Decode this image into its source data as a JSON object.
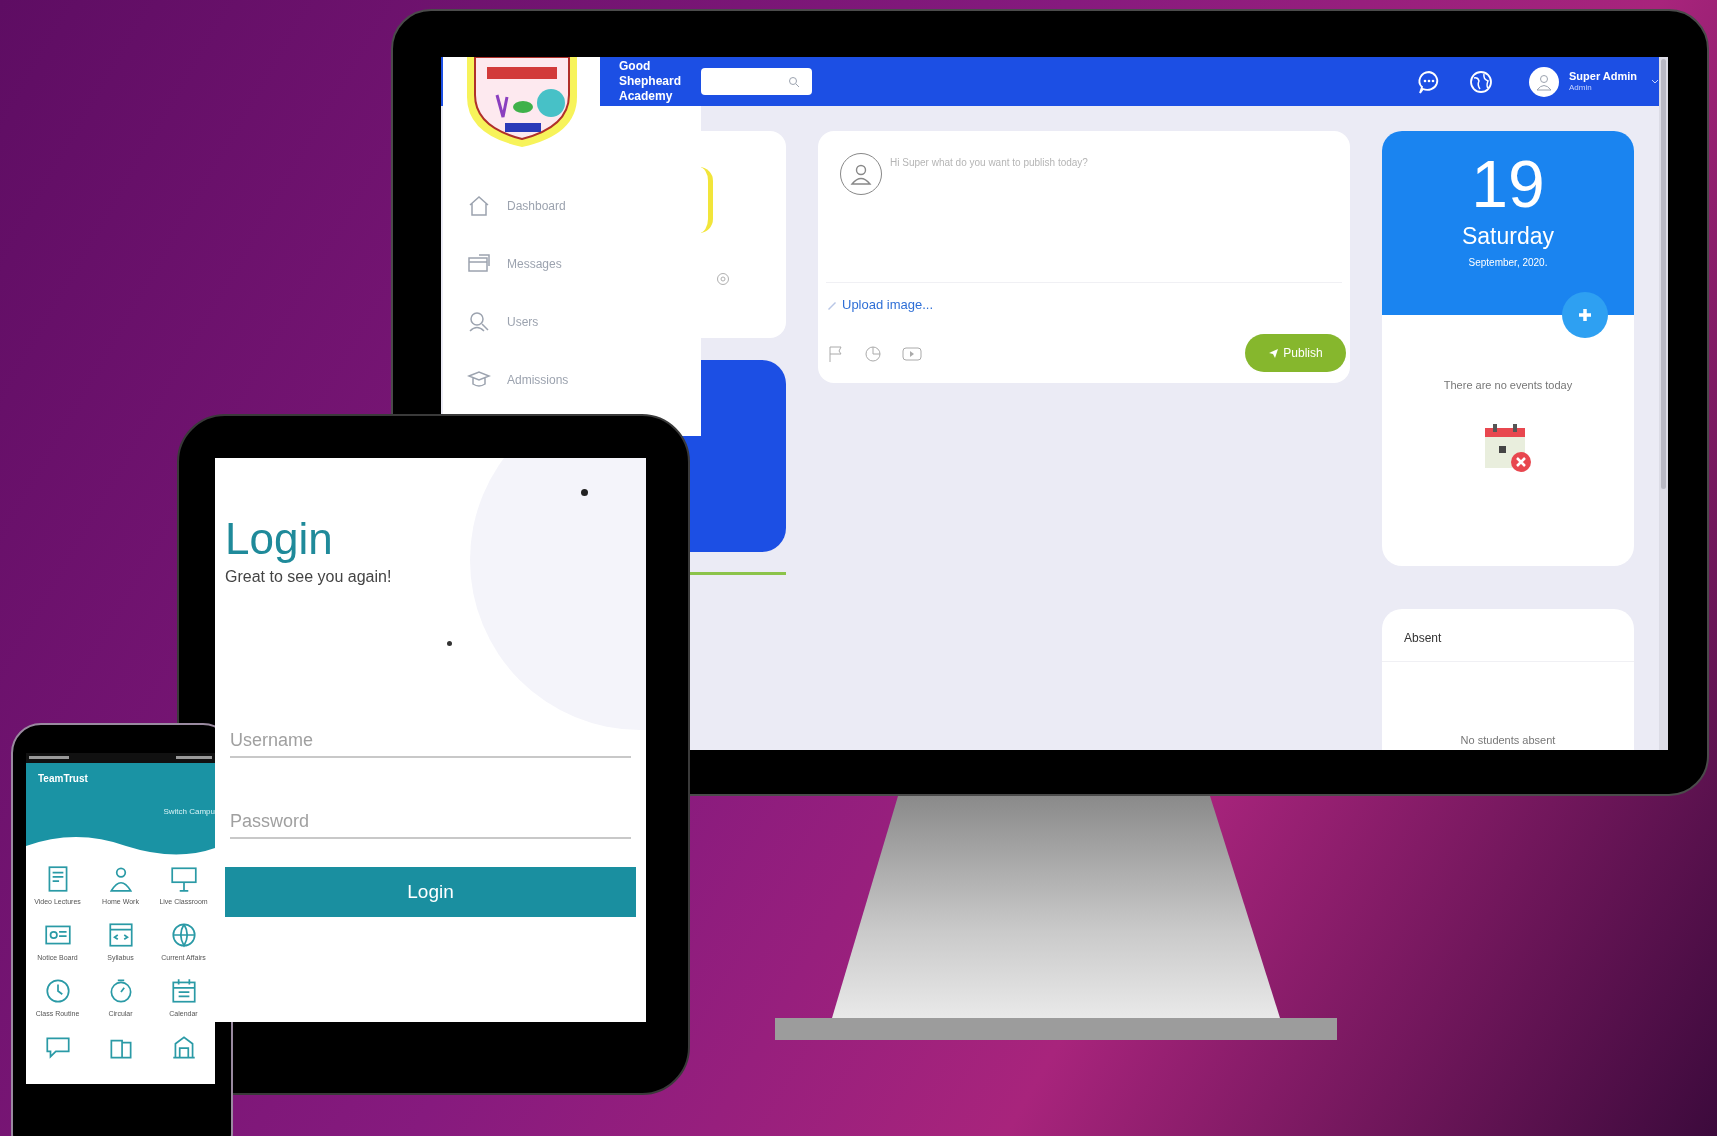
{
  "desktop": {
    "brand": "Good Shepheard Academy",
    "user": {
      "name": "Super Admin",
      "role": "Admin"
    },
    "sidebar": {
      "items": [
        {
          "label": "Dashboard"
        },
        {
          "label": "Messages"
        },
        {
          "label": "Users"
        },
        {
          "label": "Admissions"
        }
      ]
    },
    "post": {
      "placeholder": "Hi Super what do you want to publish today?",
      "upload_link": "Upload image...",
      "publish_button": "Publish"
    },
    "calendar": {
      "day": "19",
      "weekday": "Saturday",
      "month_year": "September, 2020.",
      "empty_message": "There are no events today"
    },
    "absent": {
      "title": "Absent",
      "empty_message": "No students absent"
    }
  },
  "tablet": {
    "title": "Login",
    "subtitle": "Great to see you again!",
    "username": {
      "placeholder": "Username"
    },
    "password": {
      "placeholder": "Password"
    },
    "login_button": "Login"
  },
  "phone": {
    "app_title": "TeamTrust",
    "header_link": "Switch Campu",
    "tiles": [
      {
        "kind": "labeled",
        "label": "Video Lectures"
      },
      {
        "kind": "labeled",
        "label": "Home Work"
      },
      {
        "kind": "labeled",
        "label": "Live Classroom"
      },
      {
        "kind": "labeled",
        "label": "Notice Board"
      },
      {
        "kind": "labeled",
        "label": "Syllabus"
      },
      {
        "kind": "labeled",
        "label": "Current Affairs"
      },
      {
        "kind": "labeled",
        "label": "Class Routine"
      },
      {
        "kind": "labeled",
        "label": "Circular"
      },
      {
        "kind": "labeled",
        "label": "Calendar"
      },
      {
        "kind": "icon"
      },
      {
        "kind": "icon"
      },
      {
        "kind": "icon"
      }
    ]
  }
}
